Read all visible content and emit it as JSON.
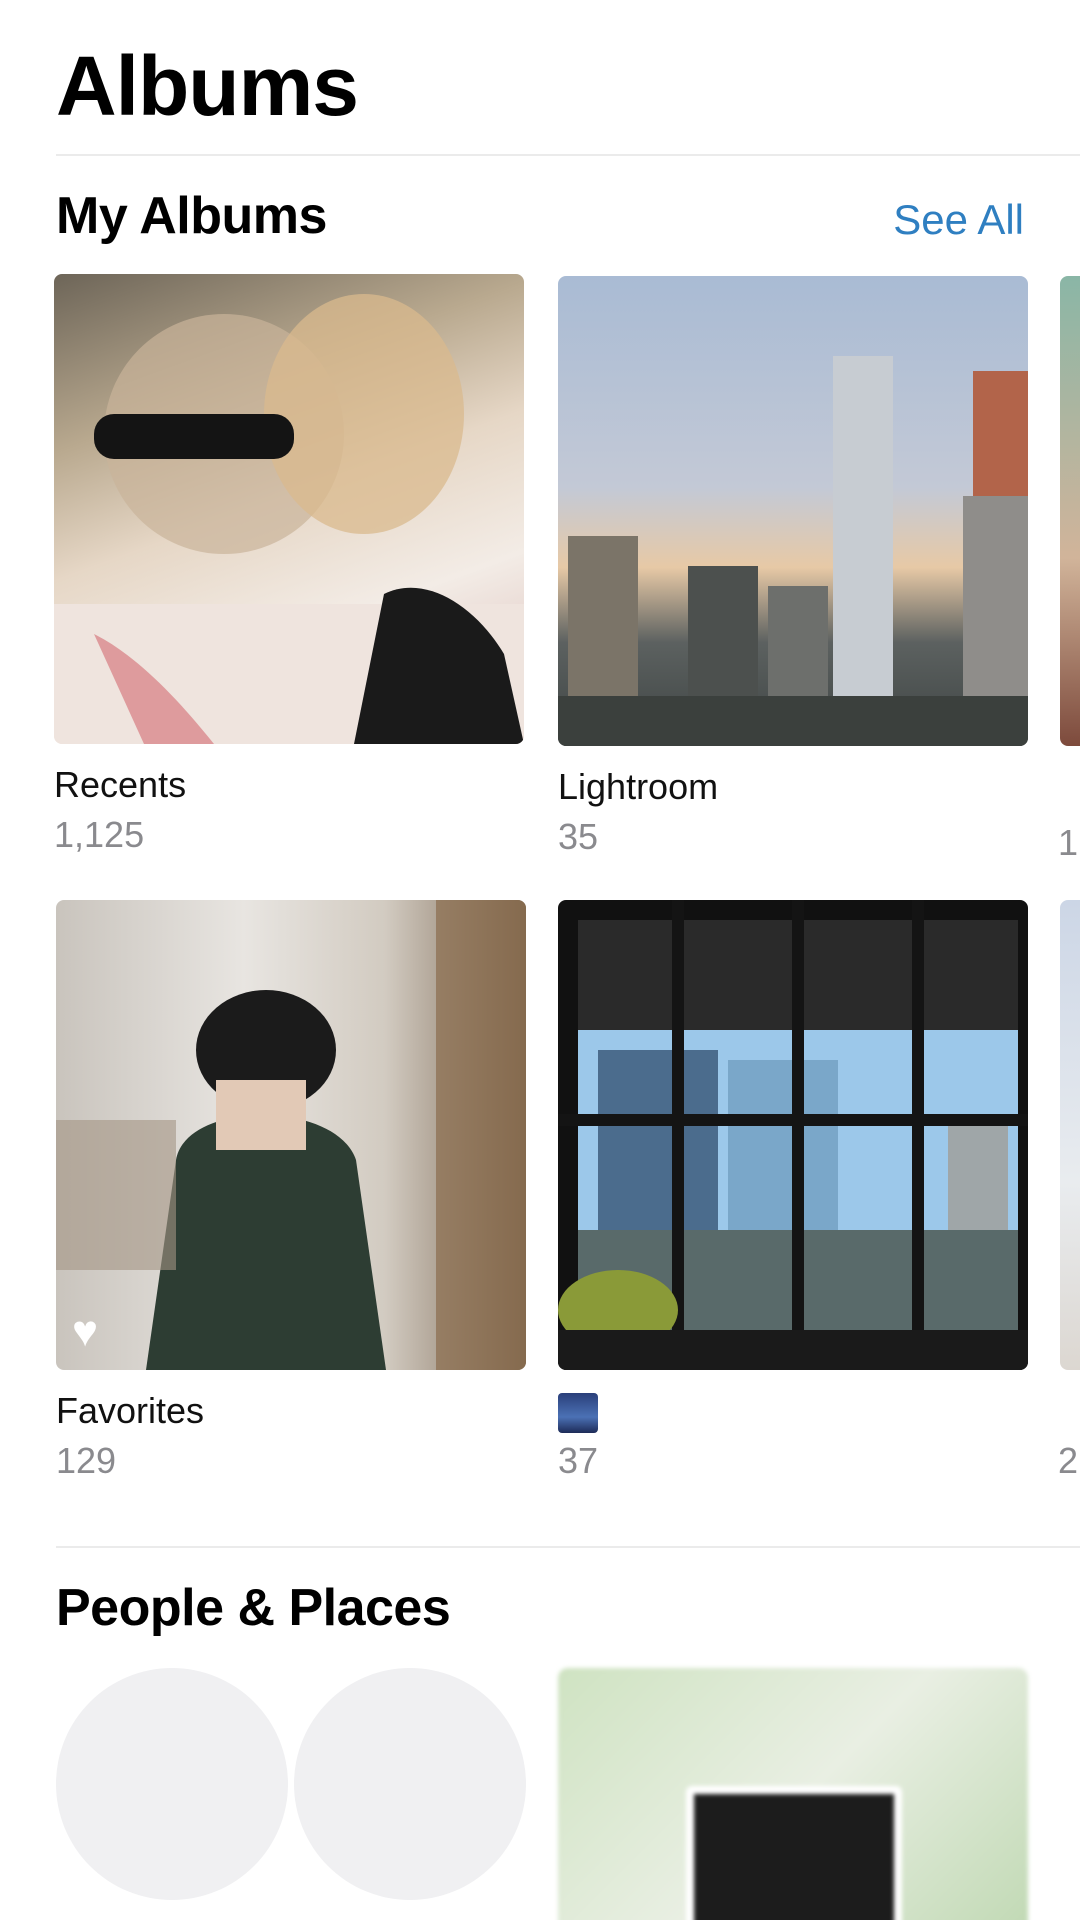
{
  "header": {
    "title": "Albums"
  },
  "my_albums": {
    "heading": "My Albums",
    "see_all": "See All",
    "items": [
      {
        "name": "Recents",
        "count": "1,125",
        "thumb": "recents-photo"
      },
      {
        "name": "Lightroom",
        "count": "35",
        "thumb": "city-skyline-photo"
      },
      {
        "name": "Favorites",
        "count": "129",
        "thumb": "mirror-selfie-photo",
        "badge": "heart-icon"
      },
      {
        "name": "",
        "count": "37",
        "thumb": "window-view-photo",
        "name_icon": "night-city-emoji"
      }
    ],
    "partial_column": [
      {
        "count_fragment": "1",
        "thumb": "partial-album-photo"
      },
      {
        "count_fragment": "2",
        "thumb": "partial-album-photo"
      }
    ]
  },
  "people_places": {
    "heading": "People & Places",
    "tiles": [
      "person-placeholder",
      "person-placeholder",
      "map-tile"
    ]
  },
  "colors": {
    "accent": "#2f7fc1",
    "secondary_text": "#8a8a8e",
    "divider": "#ebebeb"
  }
}
